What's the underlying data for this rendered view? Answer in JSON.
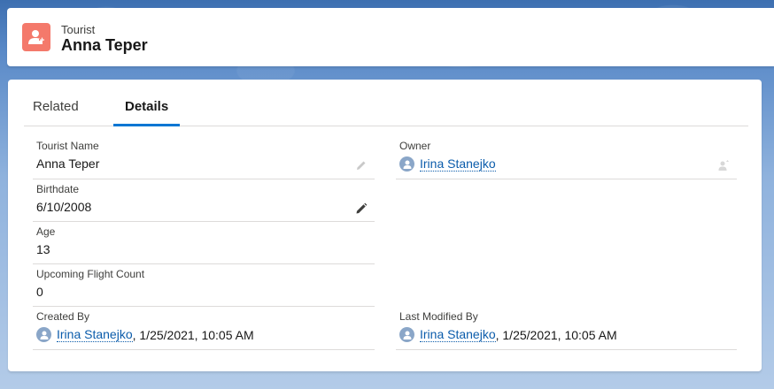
{
  "header": {
    "object_type": "Tourist",
    "record_title": "Anna Teper",
    "icon": "tourist-people-icon",
    "icon_color": "#f4796b"
  },
  "tabs": [
    {
      "label": "Related",
      "active": false
    },
    {
      "label": "Details",
      "active": true
    }
  ],
  "fields": {
    "tourist_name": {
      "label": "Tourist Name",
      "value": "Anna Teper"
    },
    "owner": {
      "label": "Owner",
      "value": "Irina Stanejko"
    },
    "birthdate": {
      "label": "Birthdate",
      "value": "6/10/2008"
    },
    "age": {
      "label": "Age",
      "value": "13"
    },
    "upcoming_flight_count": {
      "label": "Upcoming Flight Count",
      "value": "0"
    },
    "created_by": {
      "label": "Created By",
      "user": "Irina Stanejko",
      "timestamp": ", 1/25/2021, 10:05 AM"
    },
    "last_modified_by": {
      "label": "Last Modified By",
      "user": "Irina Stanejko",
      "timestamp": ", 1/25/2021, 10:05 AM"
    }
  },
  "colors": {
    "accent": "#0176d3",
    "link": "#0b5cab"
  }
}
